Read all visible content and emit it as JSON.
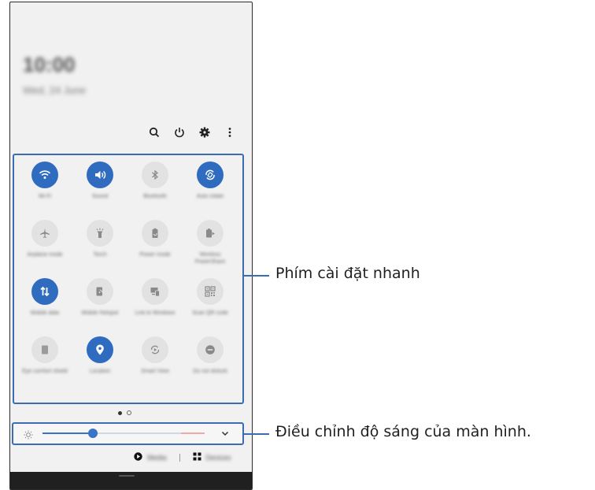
{
  "panel": {
    "clock": "10:00",
    "date": "Wed, 24 June",
    "toolbar": {
      "search_icon": "search-icon",
      "power_icon": "power-icon",
      "settings_icon": "gear-icon",
      "more_icon": "more-vertical-icon"
    },
    "tiles": [
      {
        "label": "Wi-Fi",
        "icon": "wifi-icon",
        "on": true
      },
      {
        "label": "Sound",
        "icon": "sound-icon",
        "on": true
      },
      {
        "label": "Bluetooth",
        "icon": "bluetooth-icon",
        "on": false
      },
      {
        "label": "Auto rotate",
        "icon": "auto-rotate-icon",
        "on": true
      },
      {
        "label": "Airplane mode",
        "icon": "airplane-icon",
        "on": false
      },
      {
        "label": "Torch",
        "icon": "flashlight-icon",
        "on": false
      },
      {
        "label": "Power mode",
        "icon": "battery-icon",
        "on": false
      },
      {
        "label": "Wireless PowerShare",
        "icon": "power-share-icon",
        "on": false
      },
      {
        "label": "Mobile data",
        "icon": "mobile-data-icon",
        "on": true
      },
      {
        "label": "Mobile Hotspot",
        "icon": "hotspot-icon",
        "on": false
      },
      {
        "label": "Link to Windows",
        "icon": "link-windows-icon",
        "on": false
      },
      {
        "label": "Scan QR code",
        "icon": "qr-icon",
        "on": false
      },
      {
        "label": "Eye comfort shield",
        "icon": "eye-comfort-icon",
        "on": false
      },
      {
        "label": "Location",
        "icon": "location-icon",
        "on": true
      },
      {
        "label": "Smart View",
        "icon": "smart-view-icon",
        "on": false
      },
      {
        "label": "Do not disturb",
        "icon": "do-not-disturb-icon",
        "on": false
      }
    ],
    "page_indicator": {
      "current": 1,
      "total": 2
    },
    "brightness": {
      "level": 0.31,
      "icon": "sun-icon",
      "expand_icon": "chevron-down-icon"
    },
    "media": {
      "media_label": "Media",
      "devices_label": "Devices"
    }
  },
  "callouts": {
    "quick_settings": "Phím cài đặt nhanh",
    "brightness": "Điều chỉnh độ sáng của màn hình."
  },
  "colors": {
    "accent": "#2f6cc0",
    "callout_line": "#3b6db4",
    "panel_bg": "#f1f1f1"
  }
}
